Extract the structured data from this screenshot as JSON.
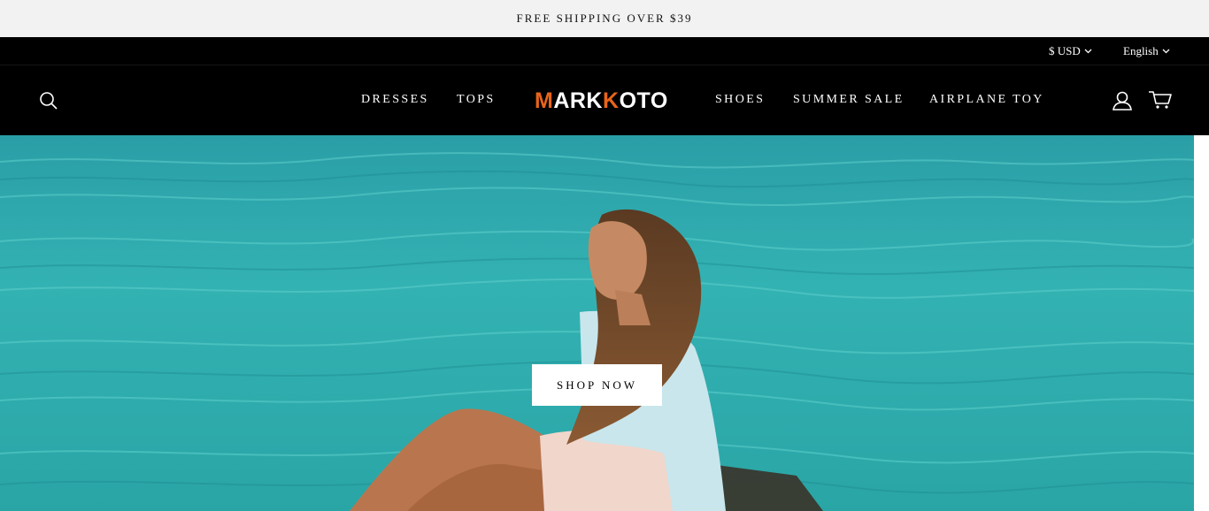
{
  "announcement": "FREE SHIPPING OVER $39",
  "utility": {
    "currency": "$ USD",
    "language": "English"
  },
  "brand": {
    "logo_first": "M",
    "logo_mid": "ARK",
    "logo_k": "K",
    "logo_end": "OTO",
    "accent_color": "#e8641b"
  },
  "nav": {
    "dresses": "DRESSES",
    "tops": "TOPS",
    "shoes": "SHOES",
    "summer_sale": "SUMMER SALE",
    "airplane_toy": "AIRPLANE TOY"
  },
  "icons": {
    "search": "search-icon",
    "account": "account-icon",
    "cart": "cart-icon",
    "dropdown": "chevron-down-icon"
  },
  "hero": {
    "cta": "SHOP NOW"
  },
  "colors": {
    "header_bg": "#000000",
    "announcement_bg": "#f2f2f2",
    "sea": "#2fb0b0"
  }
}
